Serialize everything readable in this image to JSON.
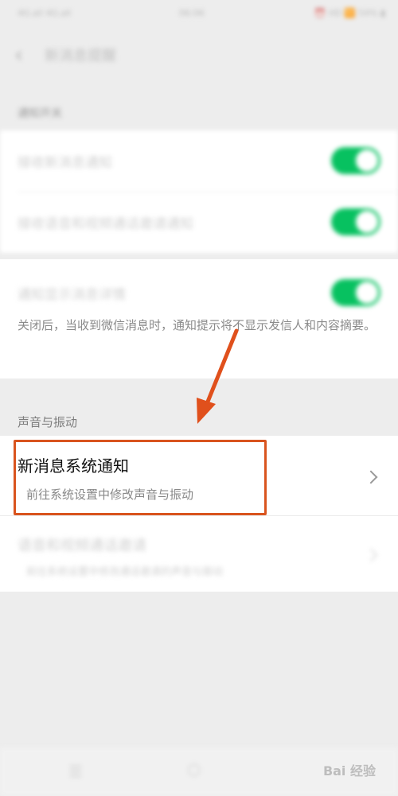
{
  "status_bar": {
    "left": "4G.all 4G.all",
    "time": "06:06",
    "right": "⏰ HD 🛜 54% ▮"
  },
  "nav": {
    "title": "新消息提醒"
  },
  "sections": {
    "notify_switch_label": "通知开关",
    "sound_label": "声音与振动"
  },
  "toggles": [
    {
      "label": "接收新消息通知",
      "on": true
    },
    {
      "label": "接收语音和视频通话邀请通知",
      "on": true
    },
    {
      "label": "通知显示消息详情",
      "on": true
    }
  ],
  "detail_desc": "关闭后，当收到微信消息时，通知提示将不显示发信人和内容摘要。",
  "highlighted_item": {
    "title": "新消息系统通知",
    "subtitle": "前往系统设置中修改声音与振动"
  },
  "second_item": {
    "title": "语音和视频通话邀请",
    "subtitle": "前往系统设置中修改通话邀请的声音与振动"
  },
  "watermark": "Bai 经验",
  "colors": {
    "toggle_on": "#07c160",
    "highlight_border": "#d9541e",
    "arrow": "#e0501c"
  }
}
